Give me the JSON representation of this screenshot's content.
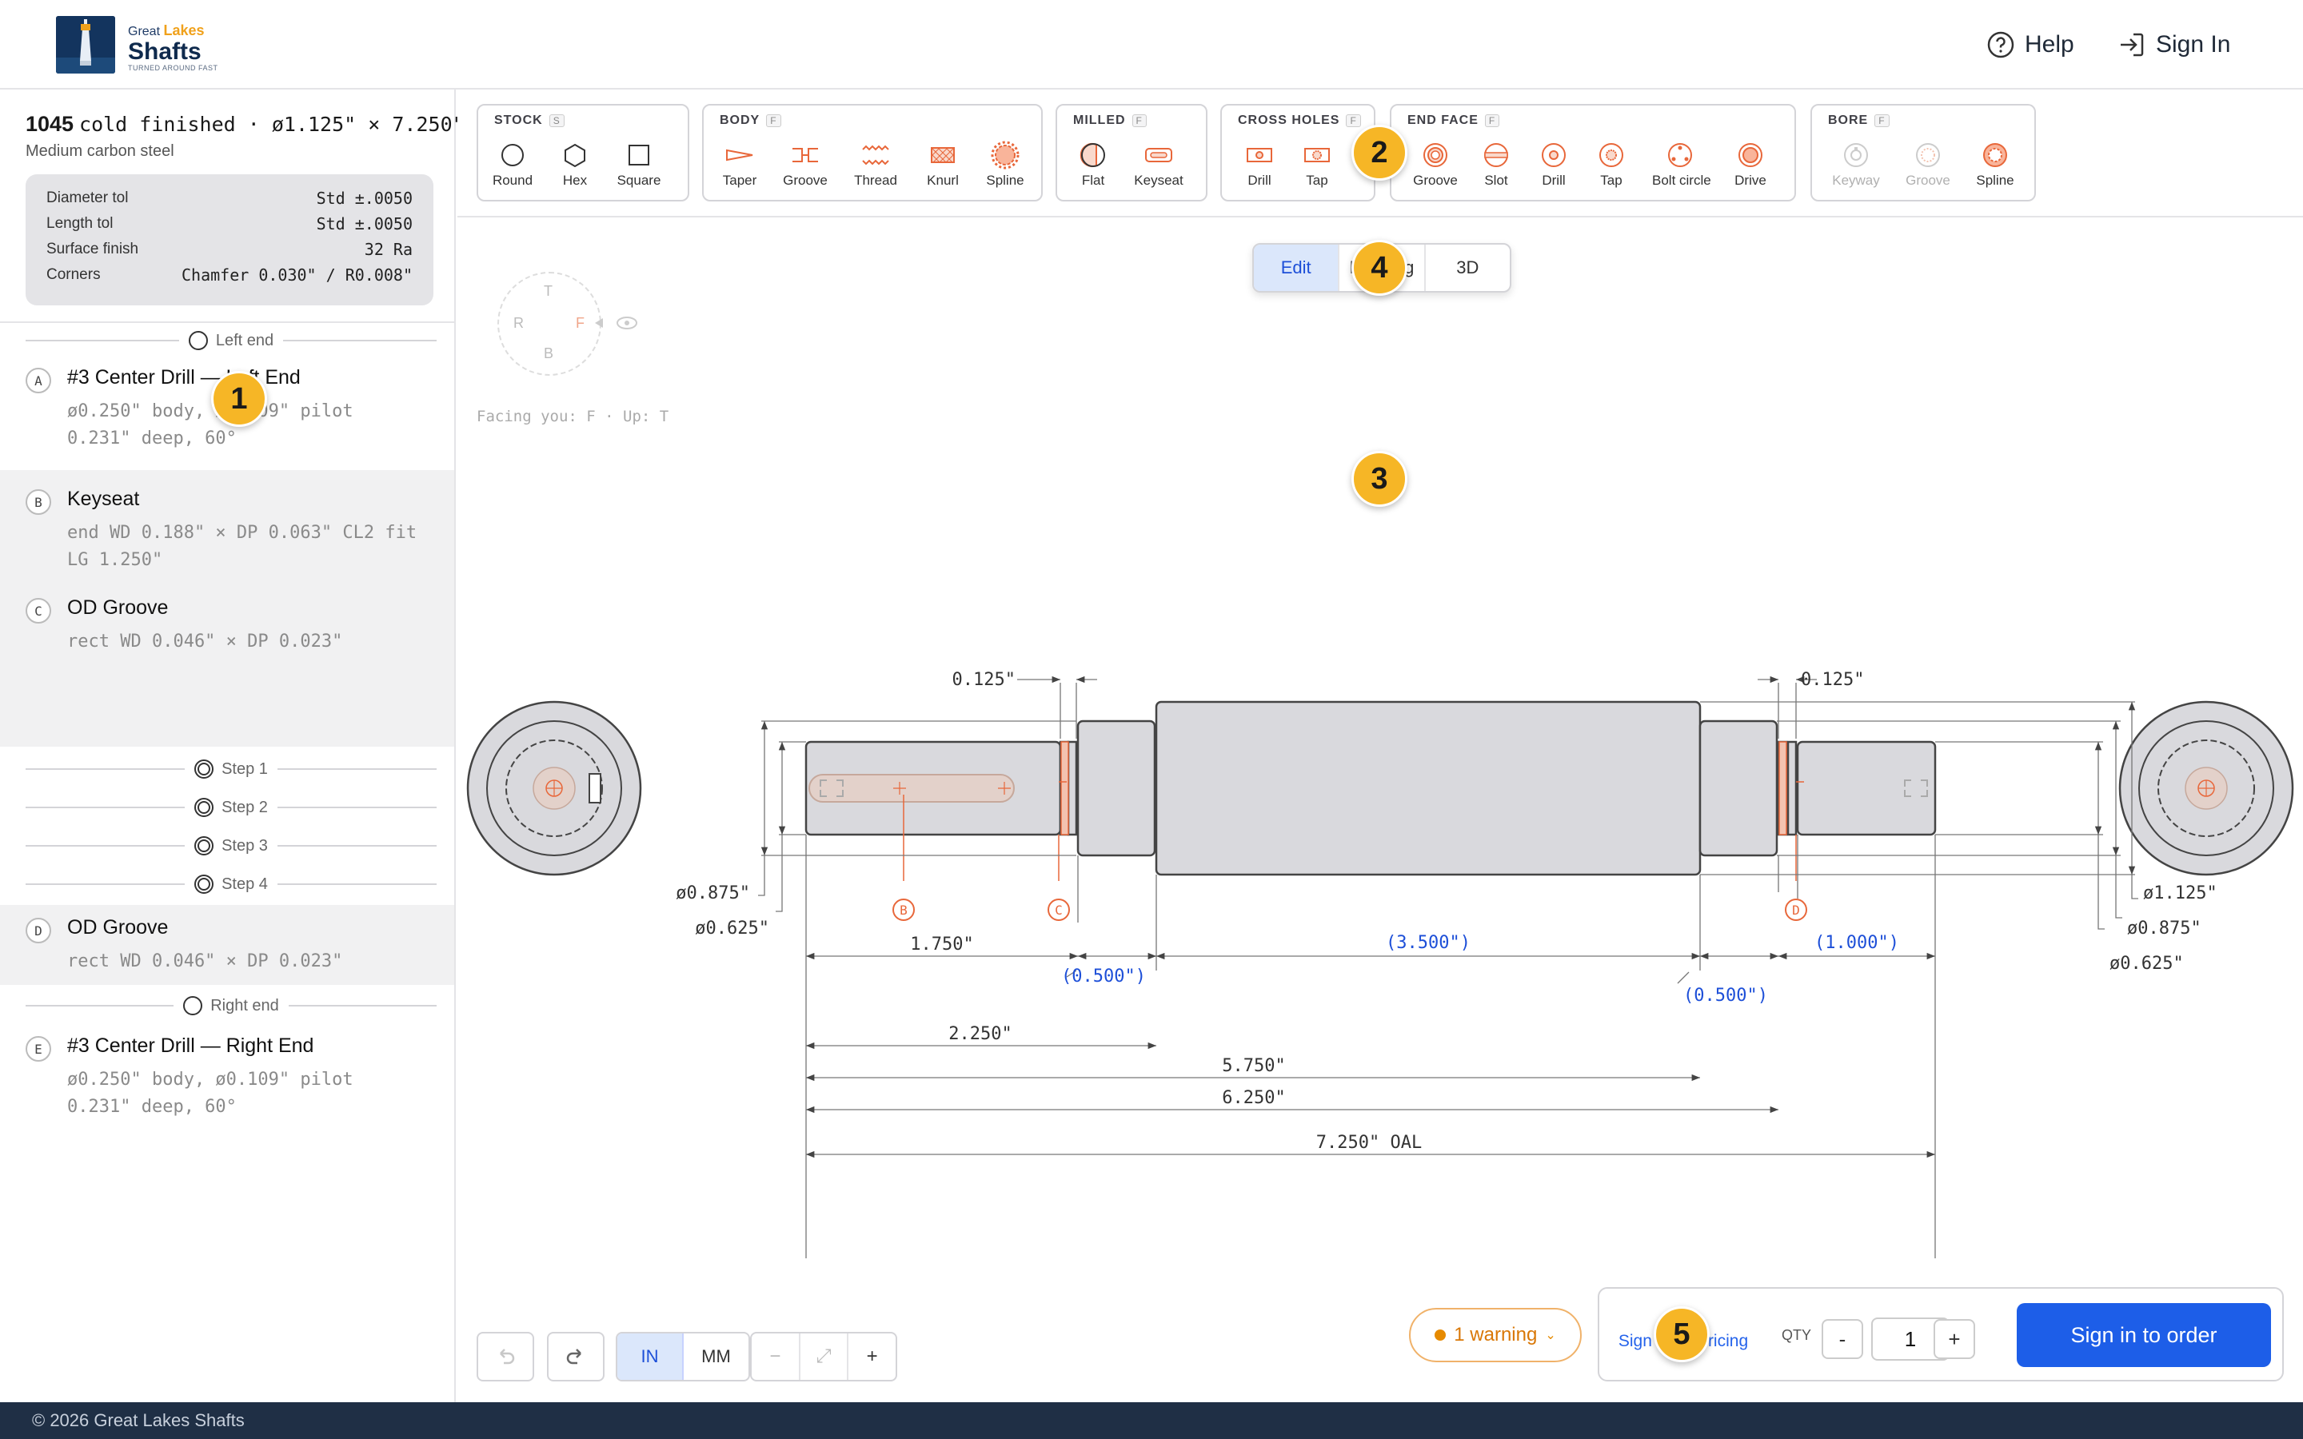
{
  "header": {
    "brand_prefix": "Great",
    "brand_accent": "Lakes",
    "brand_name": "Shafts",
    "brand_tagline": "TURNED AROUND FAST",
    "help_label": "Help",
    "signin_label": "Sign In"
  },
  "material": {
    "grade": "1045",
    "spec": "cold finished · ø1.125\" × 7.250\"",
    "description": "Medium carbon steel",
    "tolerances": [
      {
        "label": "Diameter tol",
        "value": "Std ±.0050"
      },
      {
        "label": "Length tol",
        "value": "Std ±.0050"
      },
      {
        "label": "Surface finish",
        "value": "32 Ra"
      },
      {
        "label": "Corners",
        "value": "Chamfer 0.030\" / R0.008\""
      }
    ]
  },
  "operations": {
    "left_end_label": "Left end",
    "right_end_label": "Right end",
    "steps": [
      "Step 1",
      "Step 2",
      "Step 3",
      "Step 4"
    ],
    "items": [
      {
        "badge": "A",
        "name": "#3 Center Drill — Left End",
        "line1": "ø0.250\" body, ø0.109\" pilot",
        "line2": "0.231\" deep, 60°"
      },
      {
        "badge": "B",
        "name": "Keyseat",
        "line1": "end WD 0.188\" × DP 0.063\" CL2 fit",
        "line2": "LG 1.250\""
      },
      {
        "badge": "C",
        "name": "OD Groove",
        "line1": "rect WD 0.046\" × DP 0.023\"",
        "line2": ""
      },
      {
        "badge": "D",
        "name": "OD Groove",
        "line1": "rect WD 0.046\" × DP 0.023\"",
        "line2": ""
      },
      {
        "badge": "E",
        "name": "#3 Center Drill — Right End",
        "line1": "ø0.250\" body, ø0.109\" pilot",
        "line2": "0.231\" deep, 60°"
      }
    ]
  },
  "toolbar": {
    "groups": [
      {
        "title": "STOCK",
        "key": "S",
        "tools": [
          "Round",
          "Hex",
          "Square"
        ]
      },
      {
        "title": "BODY",
        "key": "F",
        "tools": [
          "Taper",
          "Groove",
          "Thread",
          "Knurl",
          "Spline"
        ]
      },
      {
        "title": "MILLED",
        "key": "F",
        "tools": [
          "Flat",
          "Keyseat"
        ]
      },
      {
        "title": "CROSS HOLES",
        "key": "F",
        "tools": [
          "Drill",
          "Tap"
        ]
      },
      {
        "title": "END FACE",
        "key": "F",
        "tools": [
          "Groove",
          "Slot",
          "Drill",
          "Tap",
          "Bolt circle",
          "Drive"
        ]
      },
      {
        "title": "BORE",
        "key": "F",
        "tools": [
          "Keyway",
          "Groove",
          "Spline"
        ]
      }
    ]
  },
  "view": {
    "modes": [
      "Edit",
      "Drawing",
      "3D"
    ],
    "active_mode": "Edit",
    "facing_text": "Facing you: F · Up: T",
    "cube_labels": {
      "top": "T",
      "bottom": "B",
      "left": "R",
      "right": "F"
    }
  },
  "drawing": {
    "dims": {
      "chamfer_left": "0.125\"",
      "chamfer_right": "0.125\"",
      "dia_left_1": "ø0.875\"",
      "dia_left_2": "ø0.625\"",
      "dia_right_1": "ø1.125\"",
      "dia_right_2": "ø0.875\"",
      "dia_right_3": "ø0.625\"",
      "len_1": "1.750\"",
      "len_2": "(0.500\")",
      "len_3": "(3.500\")",
      "len_4": "(0.500\")",
      "len_5": "(1.000\")",
      "len_6": "2.250\"",
      "len_7": "5.750\"",
      "len_8": "6.250\"",
      "oal": "7.250\" OAL"
    },
    "feature_tags": [
      "B",
      "C",
      "D"
    ]
  },
  "controls": {
    "units": [
      "IN",
      "MM"
    ],
    "active_unit": "IN",
    "zoom_out": "−",
    "zoom_fit": "⤢",
    "zoom_in": "+"
  },
  "order": {
    "warning": "1 warning",
    "price": "—",
    "price_note": "Sign in for pricing",
    "qty_label": "QTY",
    "qty_minus": "-",
    "qty_value": "1",
    "qty_plus": "+",
    "order_button": "Sign in to order"
  },
  "callouts": [
    "1",
    "2",
    "3",
    "4",
    "5"
  ],
  "footer": {
    "copyright": "© 2026 Great Lakes Shafts"
  },
  "colors": {
    "accent": "#1d5ee8",
    "feature": "#e8673a",
    "dim_blue": "#1d4fd8",
    "callout": "#f6b626",
    "footer_bg": "#1f2f45"
  }
}
